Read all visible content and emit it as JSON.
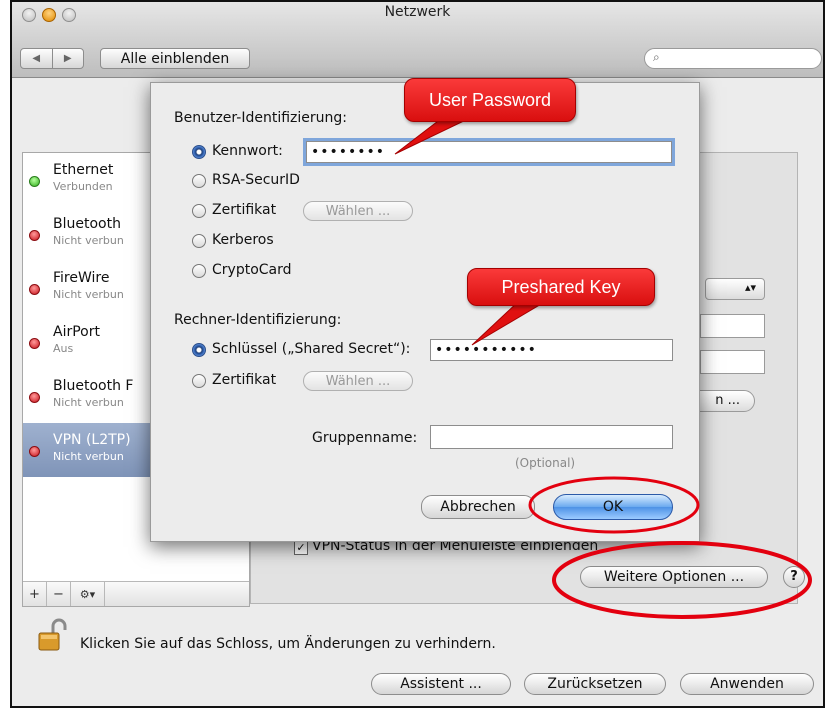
{
  "window": {
    "title": "Netzwerk",
    "back_icon": "◀",
    "forward_icon": "▶",
    "show_all": "Alle einblenden",
    "search_icon": "⌕",
    "search_placeholder": ""
  },
  "services": [
    {
      "name": "Ethernet",
      "status": "Verbunden",
      "color": "green"
    },
    {
      "name": "Bluetooth",
      "status": "Nicht verbun",
      "color": "red"
    },
    {
      "name": "FireWire",
      "status": "Nicht verbun",
      "color": "red"
    },
    {
      "name": "AirPort",
      "status": "Aus",
      "color": "red"
    },
    {
      "name": "Bluetooth F",
      "status": "Nicht verbun",
      "color": "red"
    },
    {
      "name": "VPN (L2TP)",
      "status": "Nicht verbun",
      "color": "red",
      "selected": true
    }
  ],
  "sidebar_footer": {
    "add": "+",
    "remove": "−",
    "gear": "⚙▾"
  },
  "background": {
    "auth_settings_tail": "n ...",
    "vpn_status_checkbox": "VPN-Status in der Menüleiste einblenden",
    "checkbox_mark": "✓",
    "more_options": "Weitere Optionen ...",
    "help": "?",
    "lock_text": "Klicken Sie auf das Schloss, um Änderungen zu verhindern.",
    "assistant": "Assistent ...",
    "revert": "Zurücksetzen",
    "apply": "Anwenden"
  },
  "sheet": {
    "user_auth_heading": "Benutzer-Identifizierung:",
    "user_options": [
      {
        "label": "Kennwort:",
        "selected": true
      },
      {
        "label": "RSA-SecurID"
      },
      {
        "label": "Zertifikat"
      },
      {
        "label": "Kerberos"
      },
      {
        "label": "CryptoCard"
      }
    ],
    "password_value": "••••••••",
    "choose_label": "Wählen ...",
    "machine_auth_heading": "Rechner-Identifizierung:",
    "machine_options": [
      {
        "label": "Schlüssel („Shared Secret“):",
        "selected": true
      },
      {
        "label": "Zertifikat"
      }
    ],
    "shared_secret_value": "•••••••••••",
    "choose_label_2": "Wählen ...",
    "group_name_label": "Gruppenname:",
    "group_name_value": "",
    "optional": "(Optional)",
    "cancel": "Abbrechen",
    "ok": "OK"
  },
  "annotations": {
    "user_password": "User Password",
    "preshared_key": "Preshared Key",
    "accent_color": "#e3000f"
  }
}
